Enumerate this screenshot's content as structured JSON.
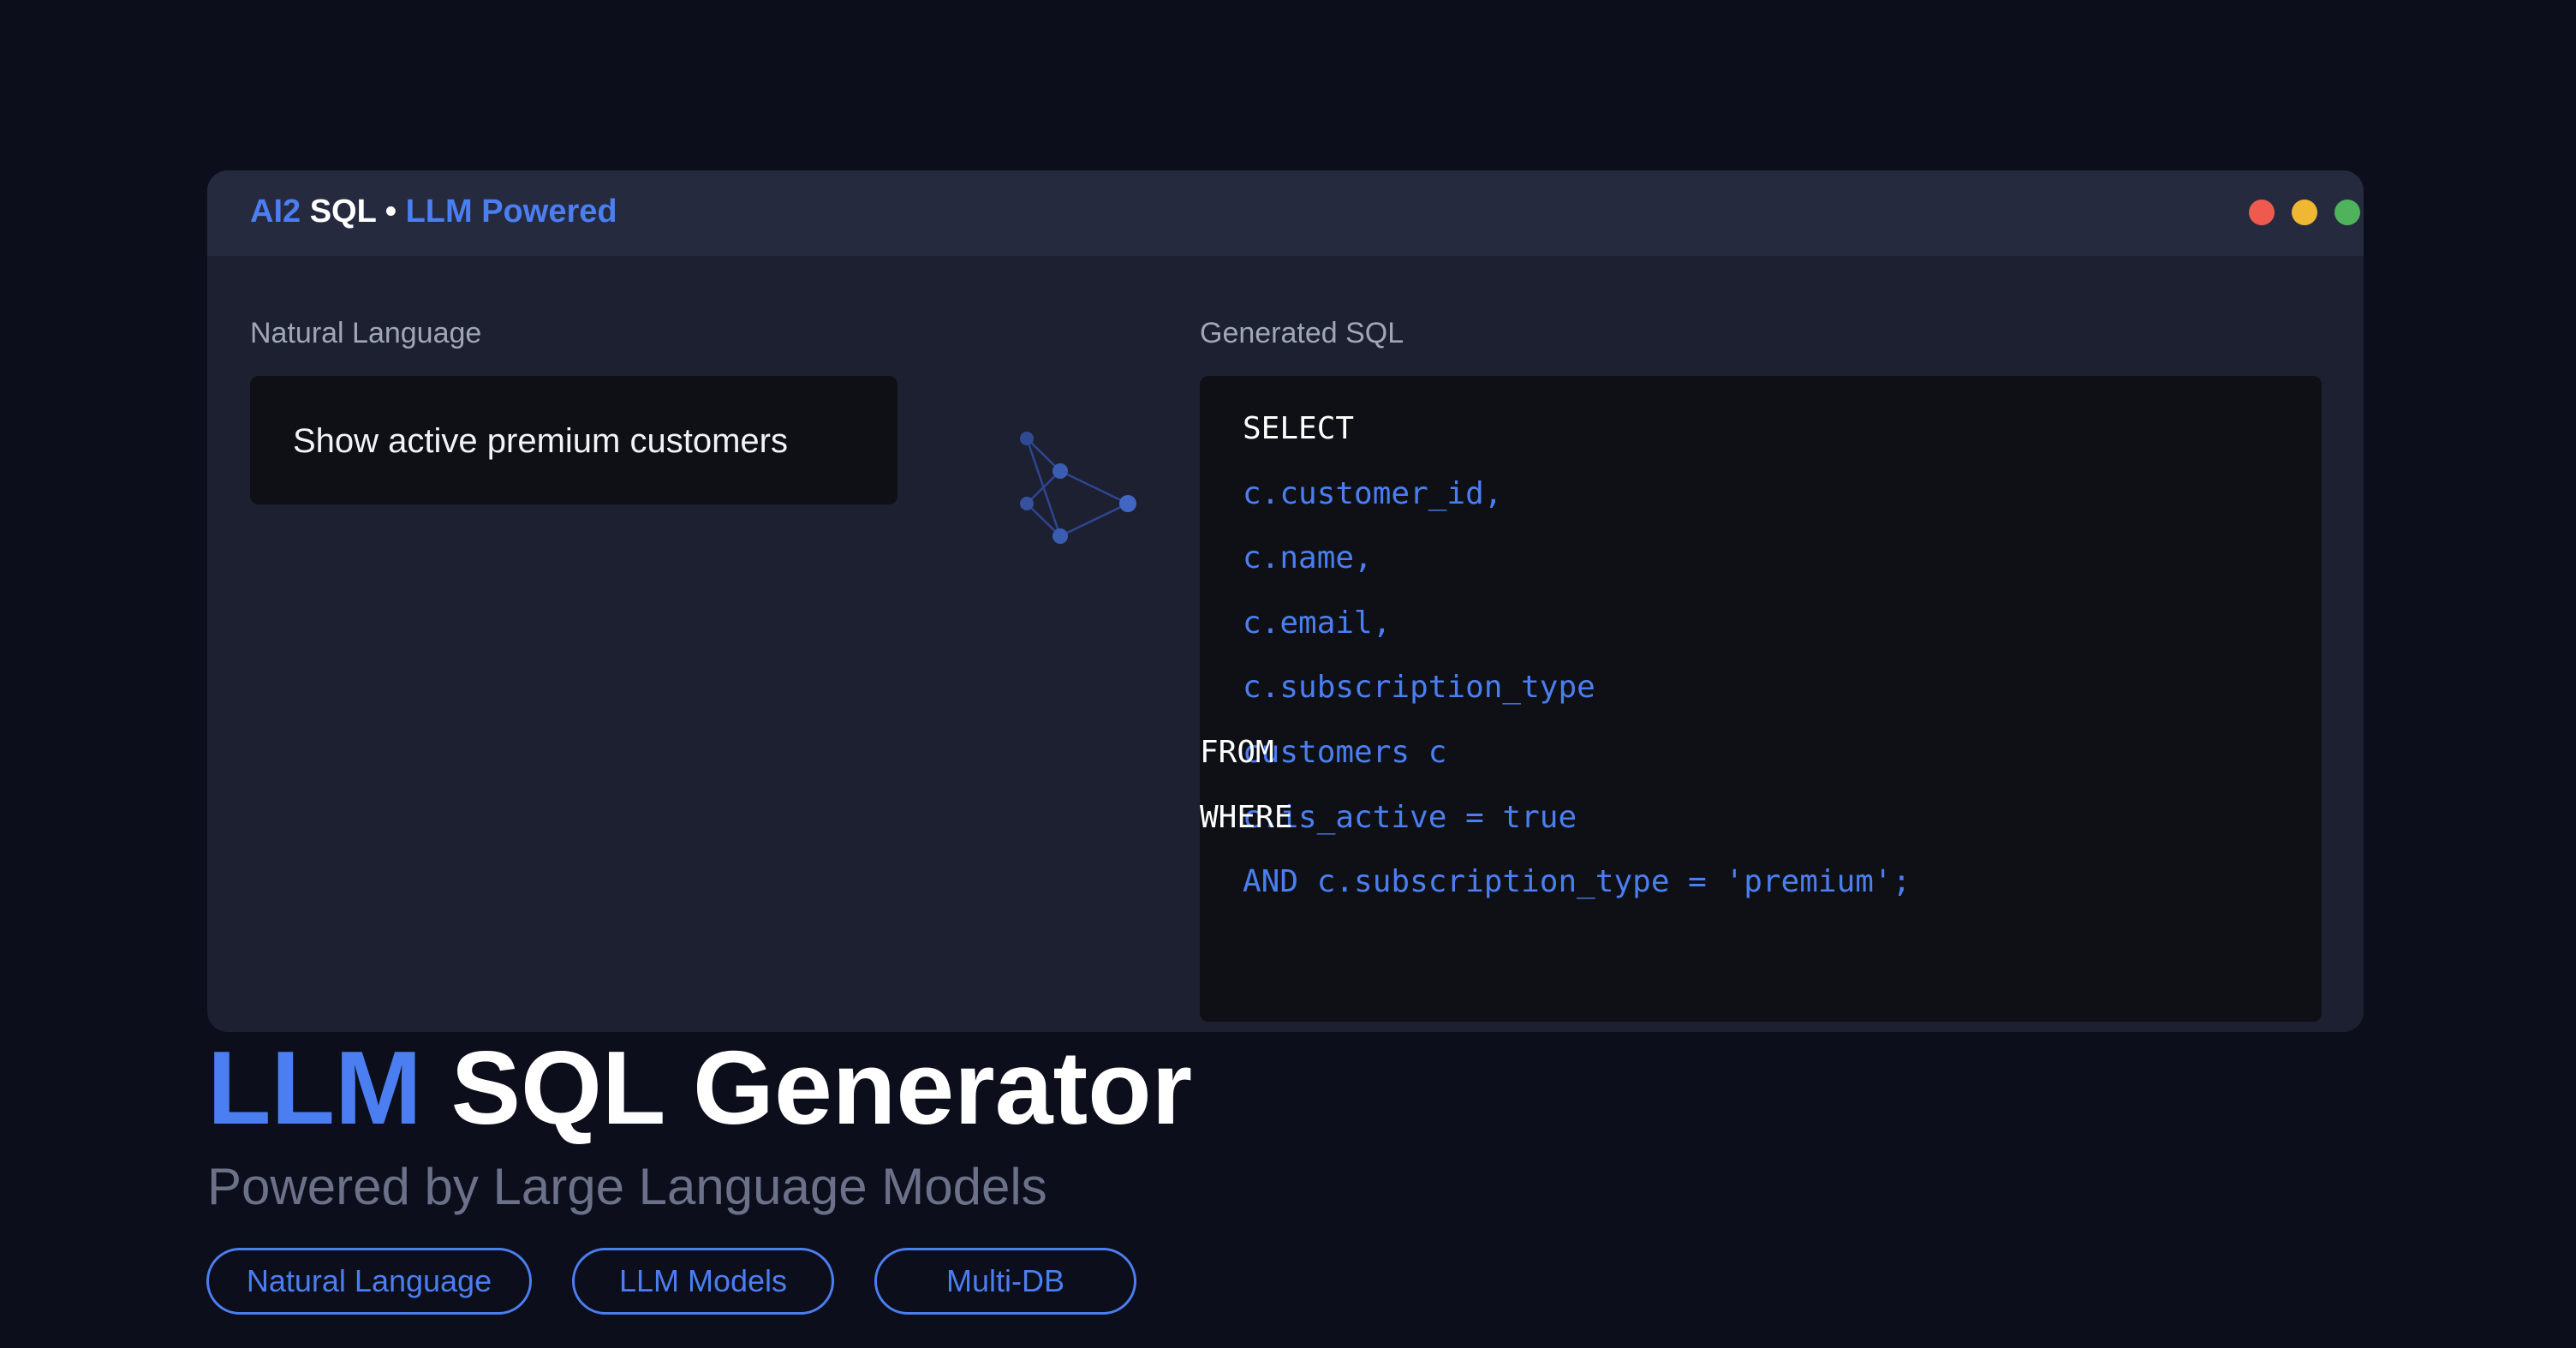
{
  "window": {
    "title_part1": "AI2",
    "title_part2": "SQL",
    "title_separator": "•",
    "title_part3": "LLM Powered",
    "controls": [
      "close",
      "minimize",
      "maximize"
    ]
  },
  "natural_language": {
    "label": "Natural Language",
    "query": "Show active premium customers"
  },
  "generated_sql": {
    "label": "Generated SQL",
    "lines": {
      "select_kw": "SELECT",
      "col1": "c.customer_id,",
      "col2": "c.name,",
      "col3": "c.email,",
      "col4": "c.subscription_type",
      "from_kw": "FROM",
      "from_table": "customers c",
      "where_kw": "WHERE",
      "where_cond": "c.is_active = true",
      "and_cond": "AND c.subscription_type = 'premium';"
    }
  },
  "hero": {
    "title_accent": "LLM",
    "title_rest": "SQL Generator",
    "subtitle": "Powered by Large Language Models"
  },
  "tags": [
    "Natural Language",
    "LLM Models",
    "Multi-DB"
  ],
  "colors": {
    "background": "#0c0e1b",
    "accent": "#4b7ef0",
    "panel": "#1d2031",
    "titlebar": "#262a3f",
    "code_bg": "#0e1016"
  },
  "icons": {
    "network": "neural-network-icon"
  }
}
